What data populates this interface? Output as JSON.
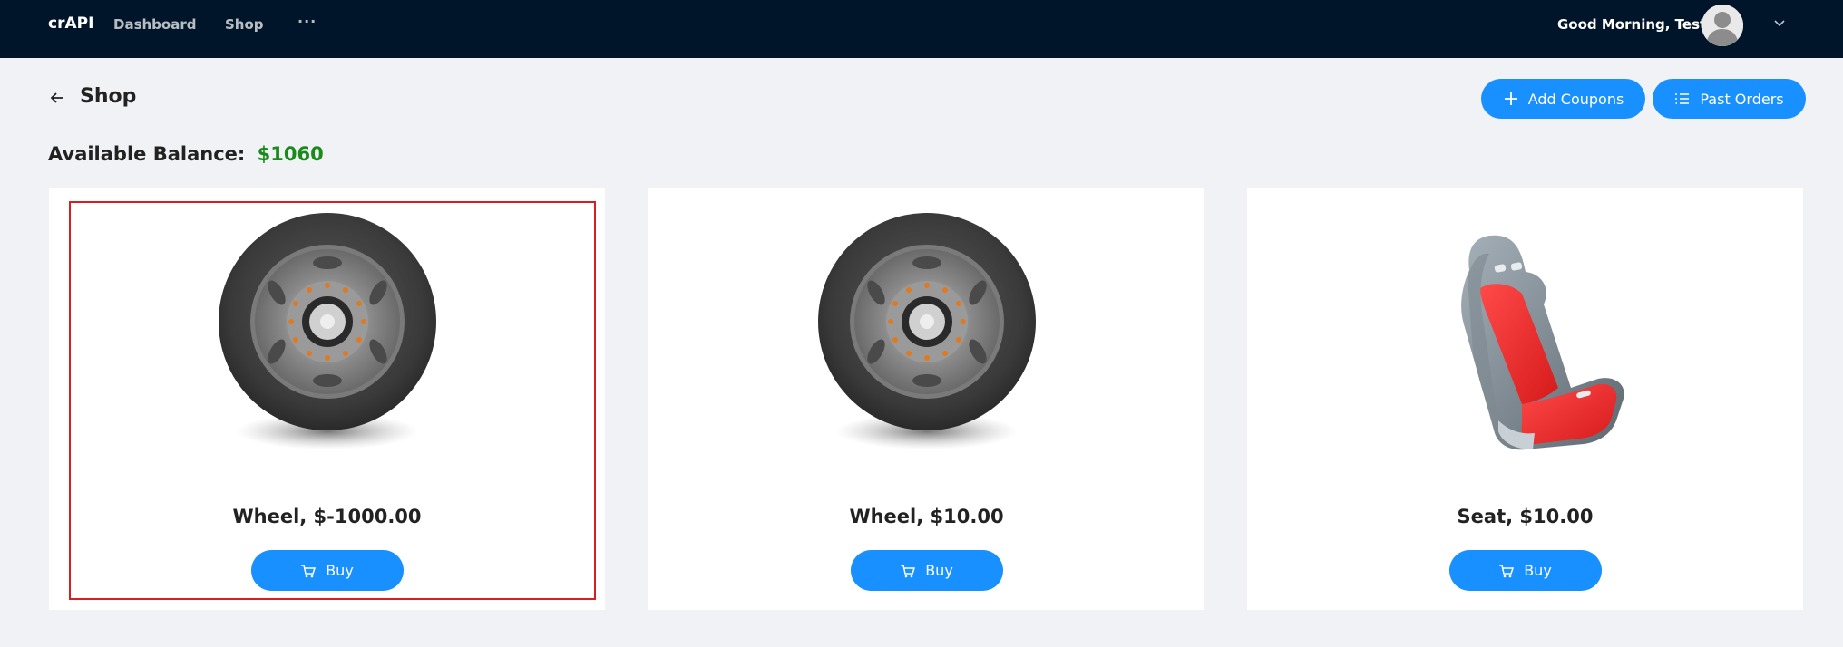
{
  "header": {
    "brand": "crAPI",
    "nav": [
      "Dashboard",
      "Shop",
      "···"
    ],
    "greeting": "Good Morning, Test!",
    "avatar_icon": "user-avatar-icon",
    "menu_icon": "chevron-down-icon"
  },
  "page": {
    "back_icon": "arrow-left-icon",
    "title": "Shop",
    "add_coupons_label": "Add Coupons",
    "past_orders_label": "Past Orders",
    "balance_label": "Available Balance:",
    "balance_value": "$1060"
  },
  "products": [
    {
      "title": "Wheel, $-1000.00",
      "image": "wheel",
      "buy_label": "Buy",
      "highlighted": true
    },
    {
      "title": "Wheel, $10.00",
      "image": "wheel",
      "buy_label": "Buy",
      "highlighted": false
    },
    {
      "title": "Seat, $10.00",
      "image": "seat",
      "buy_label": "Buy",
      "highlighted": false
    }
  ],
  "colors": {
    "header_bg": "#001529",
    "primary": "#1890ff",
    "balance": "#1a8a1a",
    "highlight": "#d81e1e",
    "page_bg": "#f0f2f5"
  }
}
